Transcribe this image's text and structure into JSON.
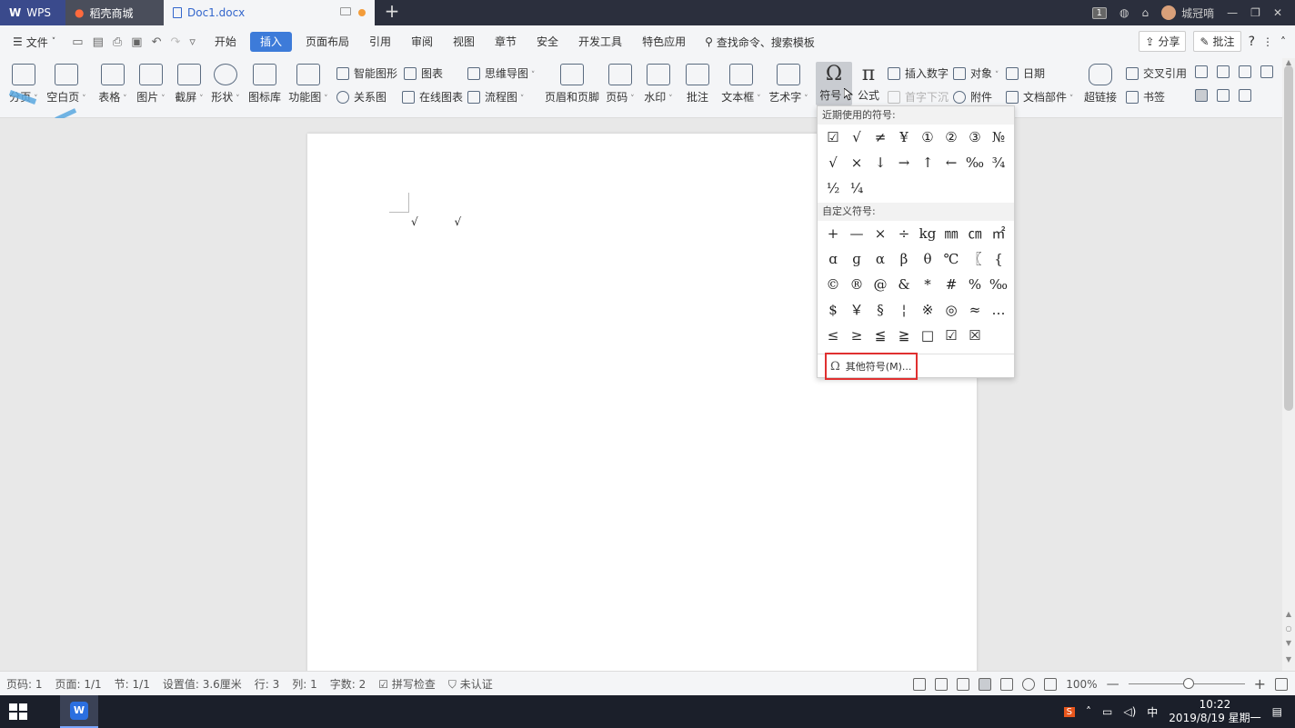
{
  "titlebar": {
    "tabs": [
      {
        "label": "WPS"
      },
      {
        "label": "稻壳商城"
      },
      {
        "label": "Doc1.docx"
      }
    ],
    "page_badge": "1",
    "user": "城冠嘀"
  },
  "menubar": {
    "file": "文件",
    "items": [
      "开始",
      "插入",
      "页面布局",
      "引用",
      "审阅",
      "视图",
      "章节",
      "安全",
      "开发工具",
      "特色应用"
    ],
    "active": "插入",
    "search": "查找命令、搜索模板",
    "share": "分享",
    "comment": "批注"
  },
  "ribbon": {
    "page": "分页",
    "blank": "空白页",
    "table": "表格",
    "picture": "图片",
    "screenshot": "截屏",
    "shape": "形状",
    "iconlib": "图标库",
    "function_chart": "功能图",
    "smart_shape": "智能图形",
    "chart": "图表",
    "mindmap": "思维导图",
    "relation": "关系图",
    "online_chart": "在线图表",
    "flowchart": "流程图",
    "header_footer": "页眉和页脚",
    "page_number": "页码",
    "watermark": "水印",
    "comment": "批注",
    "textbox": "文本框",
    "wordart": "艺术字",
    "symbol": "符号",
    "formula": "公式",
    "insert_number": "插入数字",
    "object": "对象",
    "date": "日期",
    "drop_cap": "首字下沉",
    "attachment": "附件",
    "doc_parts": "文档部件",
    "hyperlink": "超链接",
    "cross_ref": "交叉引用",
    "bookmark": "书签"
  },
  "document": {
    "text": "√ √"
  },
  "symbol_dropdown": {
    "recent_header": "近期使用的符号:",
    "recent": [
      "☑",
      "√",
      "≠",
      "¥",
      "①",
      "②",
      "③",
      "№",
      "√",
      "×",
      "↓",
      "→",
      "↑",
      "←",
      "‰",
      "¾",
      "½",
      "¼"
    ],
    "custom_header": "自定义符号:",
    "custom": [
      "+",
      "—",
      "×",
      "÷",
      "kg",
      "㎜",
      "㎝",
      "㎡",
      "ɑ",
      "ɡ",
      "α",
      "β",
      "θ",
      "℃",
      "〖",
      "{",
      "©",
      "®",
      "@",
      "&",
      "*",
      "#",
      "%",
      "‰",
      "$",
      "￥",
      "§",
      "¦",
      "※",
      "◎",
      "≈",
      "…",
      "≤",
      "≥",
      "≦",
      "≧",
      "□",
      "☑",
      "☒"
    ],
    "more": "其他符号(M)..."
  },
  "statusbar": {
    "page_code": "页码: 1",
    "page": "页面: 1/1",
    "section": "节: 1/1",
    "setting": "设置值: 3.6厘米",
    "row": "行: 3",
    "col": "列: 1",
    "words": "字数: 2",
    "spell": "拼写检查",
    "cert": "未认证",
    "zoom": "100%",
    "zoom_level": 1.0
  },
  "taskbar": {
    "time": "10:22",
    "date": "2019/8/19 星期一"
  }
}
